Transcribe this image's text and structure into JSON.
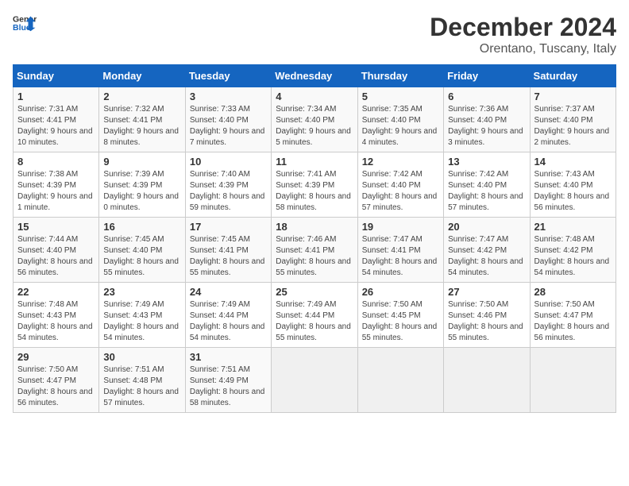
{
  "logo": {
    "line1": "General",
    "line2": "Blue"
  },
  "title": "December 2024",
  "subtitle": "Orentano, Tuscany, Italy",
  "weekdays": [
    "Sunday",
    "Monday",
    "Tuesday",
    "Wednesday",
    "Thursday",
    "Friday",
    "Saturday"
  ],
  "weeks": [
    [
      {
        "day": "1",
        "sunrise": "7:31 AM",
        "sunset": "4:41 PM",
        "daylight": "9 hours and 10 minutes."
      },
      {
        "day": "2",
        "sunrise": "7:32 AM",
        "sunset": "4:41 PM",
        "daylight": "9 hours and 8 minutes."
      },
      {
        "day": "3",
        "sunrise": "7:33 AM",
        "sunset": "4:40 PM",
        "daylight": "9 hours and 7 minutes."
      },
      {
        "day": "4",
        "sunrise": "7:34 AM",
        "sunset": "4:40 PM",
        "daylight": "9 hours and 5 minutes."
      },
      {
        "day": "5",
        "sunrise": "7:35 AM",
        "sunset": "4:40 PM",
        "daylight": "9 hours and 4 minutes."
      },
      {
        "day": "6",
        "sunrise": "7:36 AM",
        "sunset": "4:40 PM",
        "daylight": "9 hours and 3 minutes."
      },
      {
        "day": "7",
        "sunrise": "7:37 AM",
        "sunset": "4:40 PM",
        "daylight": "9 hours and 2 minutes."
      }
    ],
    [
      {
        "day": "8",
        "sunrise": "7:38 AM",
        "sunset": "4:39 PM",
        "daylight": "9 hours and 1 minute."
      },
      {
        "day": "9",
        "sunrise": "7:39 AM",
        "sunset": "4:39 PM",
        "daylight": "9 hours and 0 minutes."
      },
      {
        "day": "10",
        "sunrise": "7:40 AM",
        "sunset": "4:39 PM",
        "daylight": "8 hours and 59 minutes."
      },
      {
        "day": "11",
        "sunrise": "7:41 AM",
        "sunset": "4:39 PM",
        "daylight": "8 hours and 58 minutes."
      },
      {
        "day": "12",
        "sunrise": "7:42 AM",
        "sunset": "4:40 PM",
        "daylight": "8 hours and 57 minutes."
      },
      {
        "day": "13",
        "sunrise": "7:42 AM",
        "sunset": "4:40 PM",
        "daylight": "8 hours and 57 minutes."
      },
      {
        "day": "14",
        "sunrise": "7:43 AM",
        "sunset": "4:40 PM",
        "daylight": "8 hours and 56 minutes."
      }
    ],
    [
      {
        "day": "15",
        "sunrise": "7:44 AM",
        "sunset": "4:40 PM",
        "daylight": "8 hours and 56 minutes."
      },
      {
        "day": "16",
        "sunrise": "7:45 AM",
        "sunset": "4:40 PM",
        "daylight": "8 hours and 55 minutes."
      },
      {
        "day": "17",
        "sunrise": "7:45 AM",
        "sunset": "4:41 PM",
        "daylight": "8 hours and 55 minutes."
      },
      {
        "day": "18",
        "sunrise": "7:46 AM",
        "sunset": "4:41 PM",
        "daylight": "8 hours and 55 minutes."
      },
      {
        "day": "19",
        "sunrise": "7:47 AM",
        "sunset": "4:41 PM",
        "daylight": "8 hours and 54 minutes."
      },
      {
        "day": "20",
        "sunrise": "7:47 AM",
        "sunset": "4:42 PM",
        "daylight": "8 hours and 54 minutes."
      },
      {
        "day": "21",
        "sunrise": "7:48 AM",
        "sunset": "4:42 PM",
        "daylight": "8 hours and 54 minutes."
      }
    ],
    [
      {
        "day": "22",
        "sunrise": "7:48 AM",
        "sunset": "4:43 PM",
        "daylight": "8 hours and 54 minutes."
      },
      {
        "day": "23",
        "sunrise": "7:49 AM",
        "sunset": "4:43 PM",
        "daylight": "8 hours and 54 minutes."
      },
      {
        "day": "24",
        "sunrise": "7:49 AM",
        "sunset": "4:44 PM",
        "daylight": "8 hours and 54 minutes."
      },
      {
        "day": "25",
        "sunrise": "7:49 AM",
        "sunset": "4:44 PM",
        "daylight": "8 hours and 55 minutes."
      },
      {
        "day": "26",
        "sunrise": "7:50 AM",
        "sunset": "4:45 PM",
        "daylight": "8 hours and 55 minutes."
      },
      {
        "day": "27",
        "sunrise": "7:50 AM",
        "sunset": "4:46 PM",
        "daylight": "8 hours and 55 minutes."
      },
      {
        "day": "28",
        "sunrise": "7:50 AM",
        "sunset": "4:47 PM",
        "daylight": "8 hours and 56 minutes."
      }
    ],
    [
      {
        "day": "29",
        "sunrise": "7:50 AM",
        "sunset": "4:47 PM",
        "daylight": "8 hours and 56 minutes."
      },
      {
        "day": "30",
        "sunrise": "7:51 AM",
        "sunset": "4:48 PM",
        "daylight": "8 hours and 57 minutes."
      },
      {
        "day": "31",
        "sunrise": "7:51 AM",
        "sunset": "4:49 PM",
        "daylight": "8 hours and 58 minutes."
      },
      null,
      null,
      null,
      null
    ]
  ]
}
